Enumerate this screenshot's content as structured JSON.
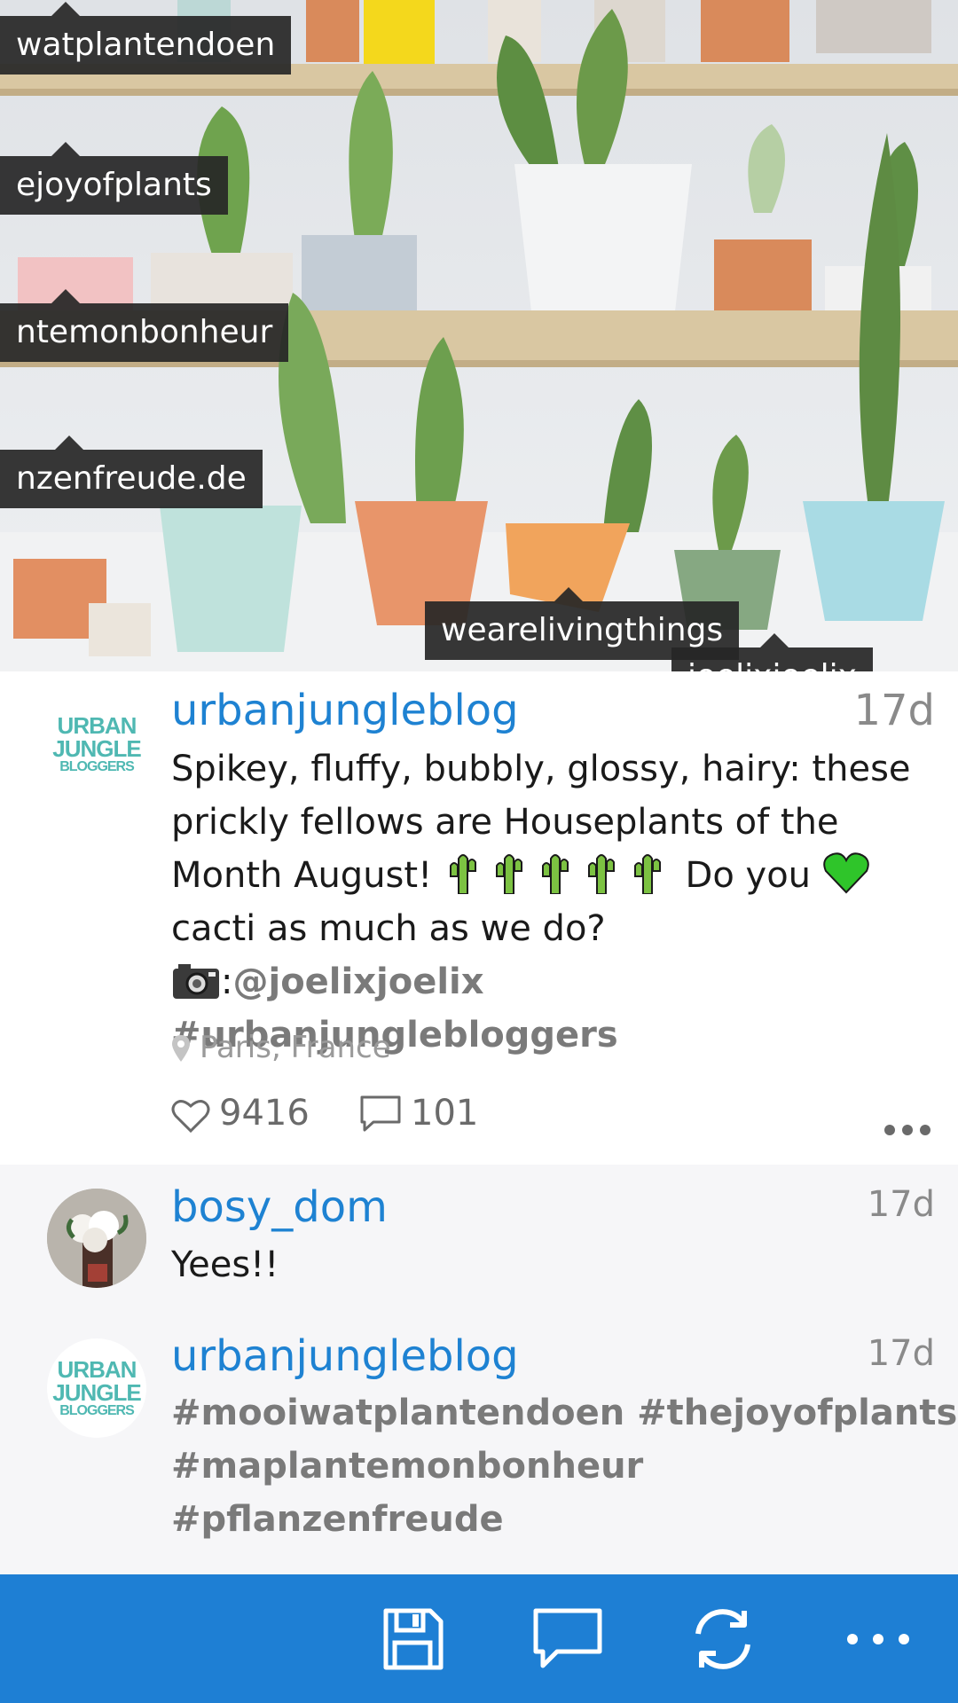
{
  "photo": {
    "tags": [
      {
        "label": "watplantendoen"
      },
      {
        "label": "ejoyofplants"
      },
      {
        "label": "ntemonbonheur"
      },
      {
        "label": "nzenfreude.de"
      },
      {
        "label": "wearelivingthings"
      },
      {
        "label": "joelixjoelix"
      }
    ]
  },
  "post": {
    "username": "urbanjungleblog",
    "time": "17d",
    "avatar_logo": {
      "line1": "URBAN",
      "line2": "JUNGLE",
      "line3": "BLOGGERS"
    },
    "caption": {
      "line1": "Spikey, fluffy, bubbly, glossy, hairy: these",
      "line2": "prickly fellows are Houseplants of the",
      "line3a": "Month August! ",
      "line3b": " Do you ",
      "line4": "cacti as much as we do?",
      "mention_prefix": ":",
      "mention": "@joelixjoelix #urbanjunglebloggers"
    },
    "location": "Paris, France",
    "likes": "9416",
    "comments_count": "101",
    "more_label": "more-options"
  },
  "comments": [
    {
      "username": "bosy_dom",
      "time": "17d",
      "text": "Yees!!"
    },
    {
      "username": "urbanjungleblog",
      "time": "17d",
      "line1": "#mooiwatplantendoen #thejoyofplants",
      "line2": "#maplantemonbonheur",
      "line3": "#pflanzenfreude"
    }
  ],
  "appbar": {
    "buttons": [
      {
        "icon": "save-icon"
      },
      {
        "icon": "comment-icon"
      },
      {
        "icon": "refresh-icon"
      },
      {
        "icon": "more-icon"
      }
    ]
  },
  "colors": {
    "accent": "#1e7fd4",
    "username": "#1e82d2",
    "hashtag": "#7a7a7a",
    "comments_bg": "#f6f6f8"
  }
}
